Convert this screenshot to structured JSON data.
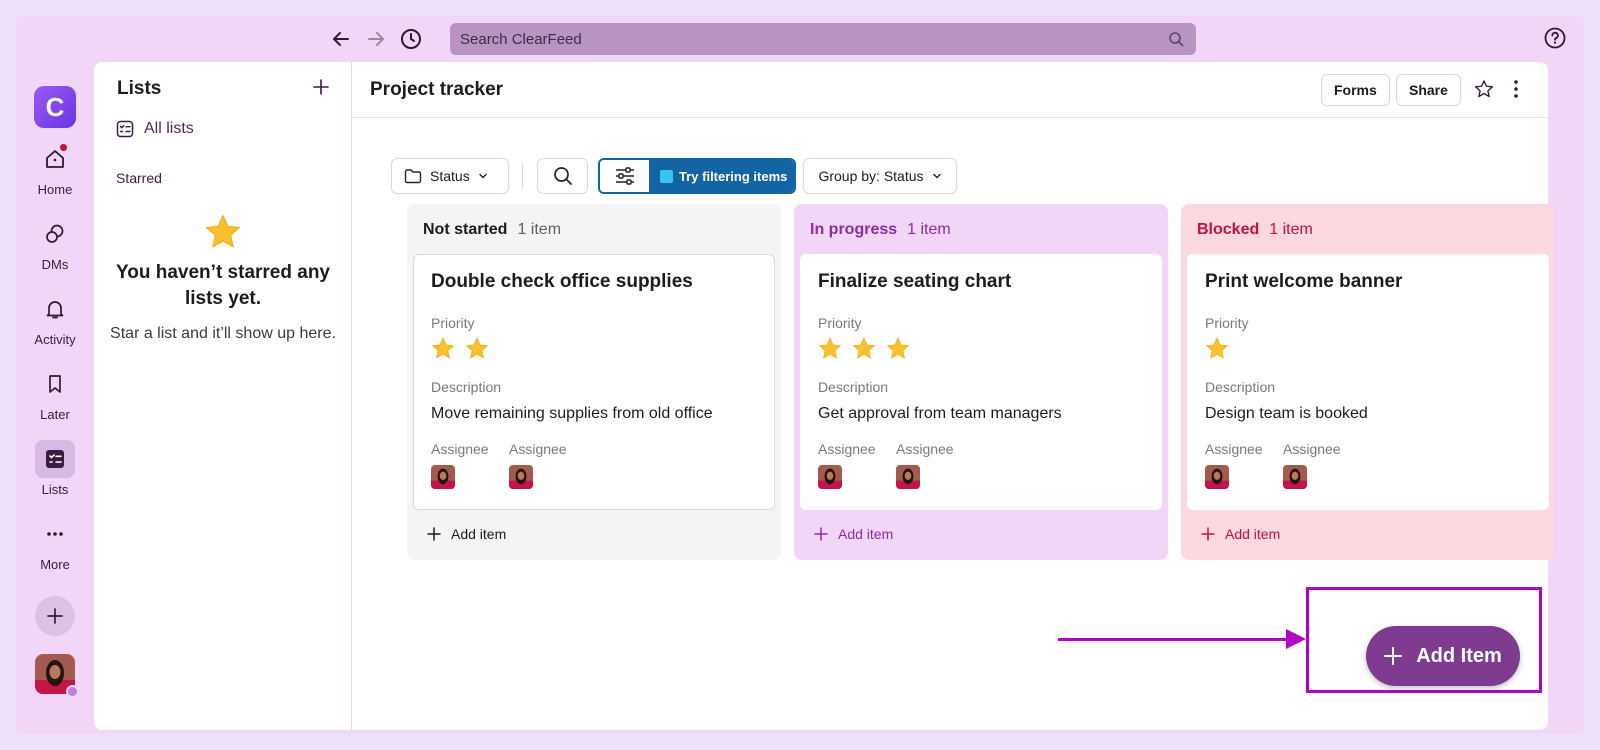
{
  "search": {
    "placeholder": "Search ClearFeed"
  },
  "rail": {
    "logo_letter": "C",
    "items": [
      {
        "label": "Home",
        "icon": "home-icon"
      },
      {
        "label": "DMs",
        "icon": "dms-icon"
      },
      {
        "label": "Activity",
        "icon": "bell-icon"
      },
      {
        "label": "Later",
        "icon": "bookmark-icon"
      },
      {
        "label": "Lists",
        "icon": "lists-icon",
        "active": true
      },
      {
        "label": "More",
        "icon": "more-icon"
      }
    ]
  },
  "sidebar": {
    "title": "Lists",
    "all_lists": "All lists",
    "starred": "Starred",
    "empty_title": "You haven’t starred any lists yet.",
    "empty_body": "Star a list and it’ll show up here."
  },
  "header": {
    "title": "Project tracker",
    "forms": "Forms",
    "share": "Share"
  },
  "toolbar": {
    "status": "Status",
    "filter_tip": "Try filtering items",
    "group_by": "Group by: Status"
  },
  "columns": [
    {
      "name": "Not started",
      "count": "1 item",
      "accent": "#1d1c1d",
      "card": {
        "title": "Double check office supplies",
        "priority_label": "Priority",
        "priority": 2,
        "description_label": "Description",
        "description": "Move remaining supplies from old office",
        "assignee_label_1": "Assignee",
        "assignee_label_2": "Assignee"
      },
      "add_label": "Add item"
    },
    {
      "name": "In progress",
      "count": "1 item",
      "accent": "#8a2ea0",
      "card": {
        "title": "Finalize seating chart",
        "priority_label": "Priority",
        "priority": 3,
        "description_label": "Description",
        "description": "Get approval from team managers",
        "assignee_label_1": "Assignee",
        "assignee_label_2": "Assignee"
      },
      "add_label": "Add item"
    },
    {
      "name": "Blocked",
      "count": "1 item",
      "accent": "#c4103a",
      "card": {
        "title": "Print welcome banner",
        "priority_label": "Priority",
        "priority": 1,
        "description_label": "Description",
        "description": "Design team is booked",
        "assignee_label_1": "Assignee",
        "assignee_label_2": "Assignee"
      },
      "add_label": "Add item"
    }
  ],
  "fab": {
    "label": "Add Item"
  }
}
